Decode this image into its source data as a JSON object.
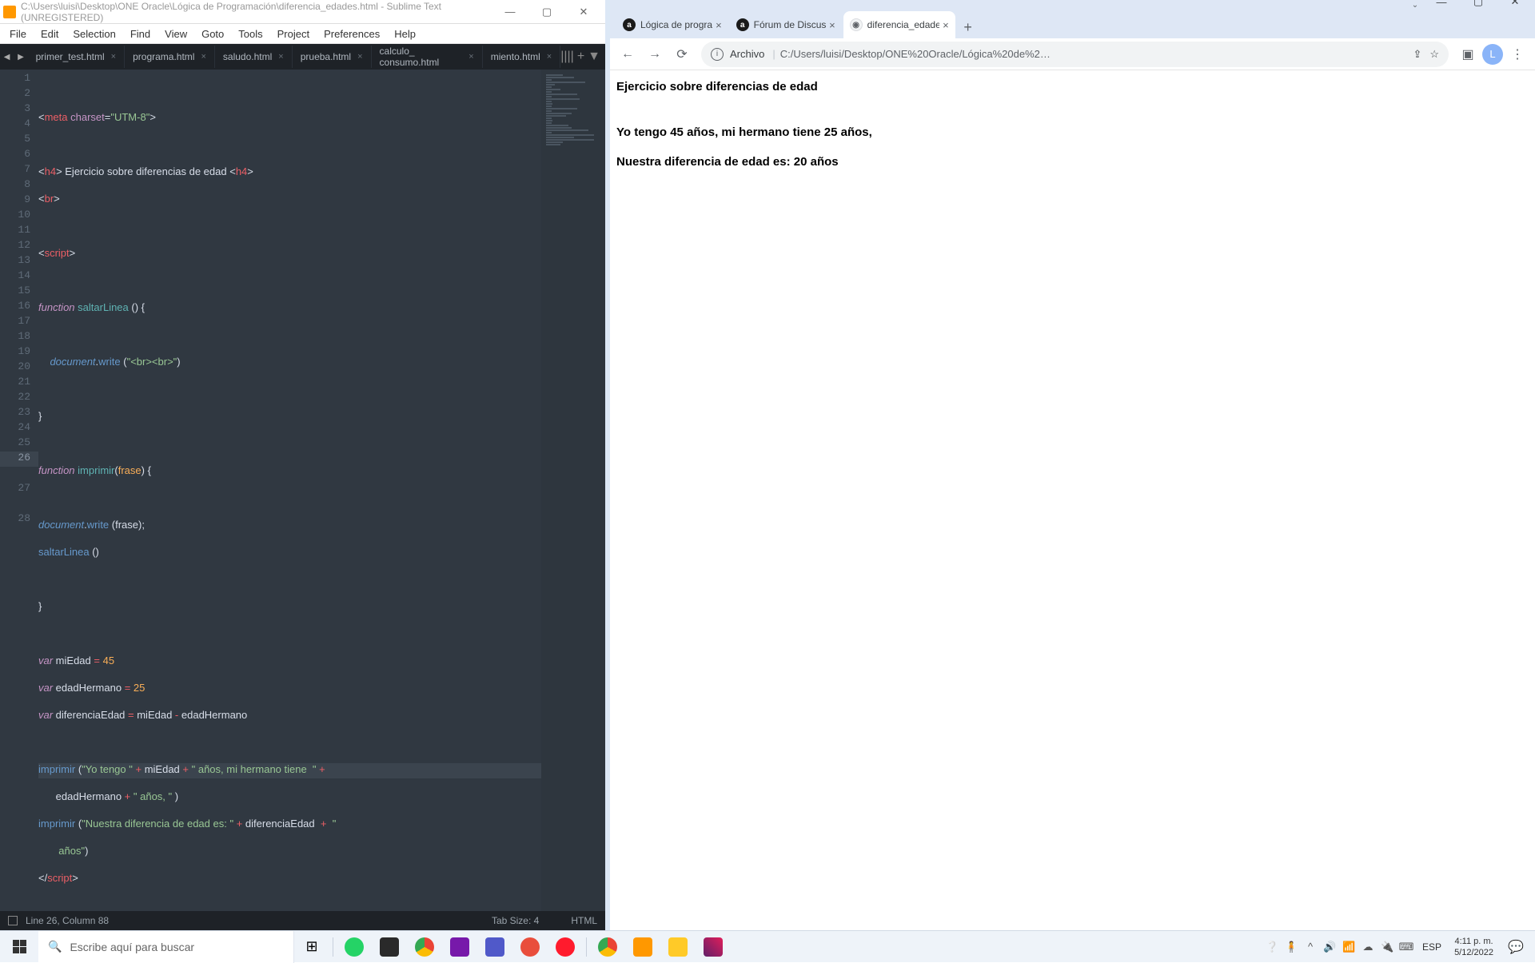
{
  "sublime": {
    "title": "C:\\Users\\luisi\\Desktop\\ONE Oracle\\Lógica de Programación\\diferencia_edades.html - Sublime Text (UNREGISTERED)",
    "menu": [
      "File",
      "Edit",
      "Selection",
      "Find",
      "View",
      "Goto",
      "Tools",
      "Project",
      "Preferences",
      "Help"
    ],
    "tabs": [
      "primer_test.html",
      "programa.html",
      "saludo.html",
      "prueba.html",
      "calculo_ consumo.html",
      "miento.html"
    ],
    "status": {
      "pos": "Line 26, Column 88",
      "tabsize": "Tab Size: 4",
      "syntax": "HTML"
    }
  },
  "chrome": {
    "tabs": [
      {
        "label": "Lógica de progra",
        "fav": "a"
      },
      {
        "label": "Fórum de Discus",
        "fav": "a"
      },
      {
        "label": "diferencia_edade",
        "fav": "g",
        "active": true
      }
    ],
    "url_label": "Archivo",
    "url_path": "C:/Users/luisi/Desktop/ONE%20Oracle/Lógica%20de%2…",
    "avatar": "L",
    "content": {
      "heading": "Ejercicio sobre diferencias de edad",
      "line1": "Yo tengo 45 años, mi hermano tiene 25 años,",
      "line2": "Nuestra diferencia de edad es: 20 años"
    }
  },
  "taskbar": {
    "search_placeholder": "Escribe aquí para buscar",
    "lang": "ESP",
    "time": "4:11 p. m.",
    "date": "5/12/2022"
  }
}
